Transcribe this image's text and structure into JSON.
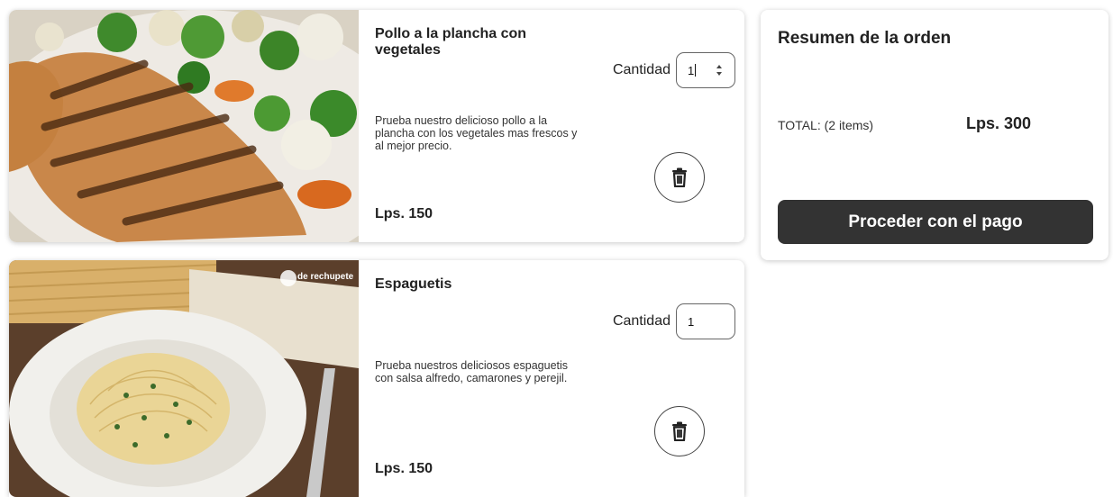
{
  "products": [
    {
      "name": "Pollo a la plancha con vegetales",
      "description": "Prueba nuestro delicioso pollo a la plancha con los vegetales mas frescos y al mejor precio.",
      "price": "Lps. 150",
      "quantity_label": "Cantidad",
      "quantity_value": "1",
      "image_icon": "grilled-chicken-image",
      "delete_icon": "trash-icon"
    },
    {
      "name": "Espaguetis",
      "description": "Prueba nuestros deliciosos espaguetis con salsa alfredo, camarones y perejil.",
      "price": "Lps. 150",
      "quantity_label": "Cantidad",
      "quantity_value": "1",
      "image_icon": "spaghetti-image",
      "delete_icon": "trash-icon",
      "image_watermark": "de rechupete"
    }
  ],
  "summary": {
    "title": "Resumen de la orden",
    "total_label": "TOTAL: (2 items)",
    "total_value": "Lps. 300",
    "pay_button": "Proceder con el pago"
  },
  "colors": {
    "button_dark": "#333333",
    "card_background": "#ffffff"
  }
}
